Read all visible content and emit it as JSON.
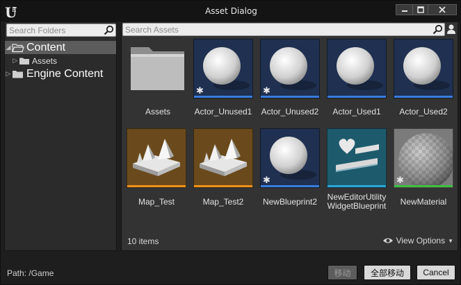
{
  "window": {
    "title": "Asset Dialog"
  },
  "left_panel": {
    "search_placeholder": "Search Folders",
    "tree": [
      {
        "label": "Content",
        "expanded": true,
        "selected": true
      },
      {
        "label": "Assets",
        "child": true
      },
      {
        "label": "Engine Content",
        "expanded": false
      }
    ]
  },
  "right_panel": {
    "search_placeholder": "Search Assets",
    "assets": [
      {
        "name": "Assets",
        "kind": "folder"
      },
      {
        "name": "Actor_Unused1",
        "kind": "blueprint",
        "bar": "#3a7de0"
      },
      {
        "name": "Actor_Unused2",
        "kind": "blueprint",
        "bar": "#3a7de0"
      },
      {
        "name": "Actor_Used1",
        "kind": "blueprint",
        "bar": "#3a7de0"
      },
      {
        "name": "Actor_Used2",
        "kind": "blueprint",
        "bar": "#3a7de0"
      },
      {
        "name": "Map_Test",
        "kind": "map",
        "bar": "#f0901c"
      },
      {
        "name": "Map_Test2",
        "kind": "map",
        "bar": "#f0901c"
      },
      {
        "name": "NewBlueprint2",
        "kind": "blueprint",
        "bar": "#3a7de0"
      },
      {
        "name_line1": "NewEditorUtility",
        "name_line2": "WidgetBlueprint",
        "kind": "widget",
        "bar": "#2aa6d6"
      },
      {
        "name": "NewMaterial",
        "kind": "material",
        "bar": "#3cc040"
      }
    ],
    "items_count": "10 items",
    "view_options": "View Options"
  },
  "footer": {
    "path": "Path:  /Game",
    "move_button": "移动",
    "move_all_button": "全部移动",
    "cancel_button": "Cancel"
  }
}
